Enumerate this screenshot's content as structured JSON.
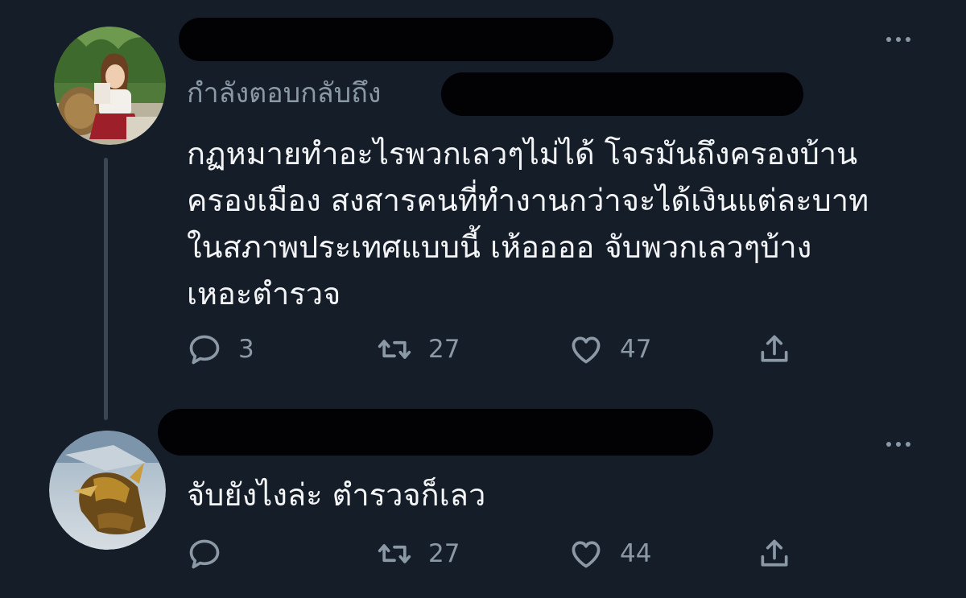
{
  "tweet1": {
    "reply_to_label": "กำลังตอบกลับถึง",
    "text_lines": [
      "กฏหมายทำอะไรพวกเลวๆไม่ได้ โจรมันถึงครองบ้าน",
      "ครองเมือง สงสารคนที่ทำงานกว่าจะได้เงินแต่ละบาท",
      "ในสภาพประเทศแบบนี้ เห้ออออ จับพวกเลวๆบ้าง",
      "เหอะตำรวจ"
    ],
    "reply_count": "3",
    "retweet_count": "27",
    "like_count": "47"
  },
  "tweet2": {
    "text": "จับยังไงล่ะ ตำรวจก็เลว",
    "reply_count": "",
    "retweet_count": "27",
    "like_count": "44"
  },
  "icons": {
    "reply": "reply-icon",
    "retweet": "retweet-icon",
    "like": "heart-icon",
    "share": "share-icon",
    "more": "more-icon"
  },
  "colors": {
    "background": "#151d29",
    "text_primary": "#f2f4f6",
    "text_secondary": "#8b98a5"
  }
}
